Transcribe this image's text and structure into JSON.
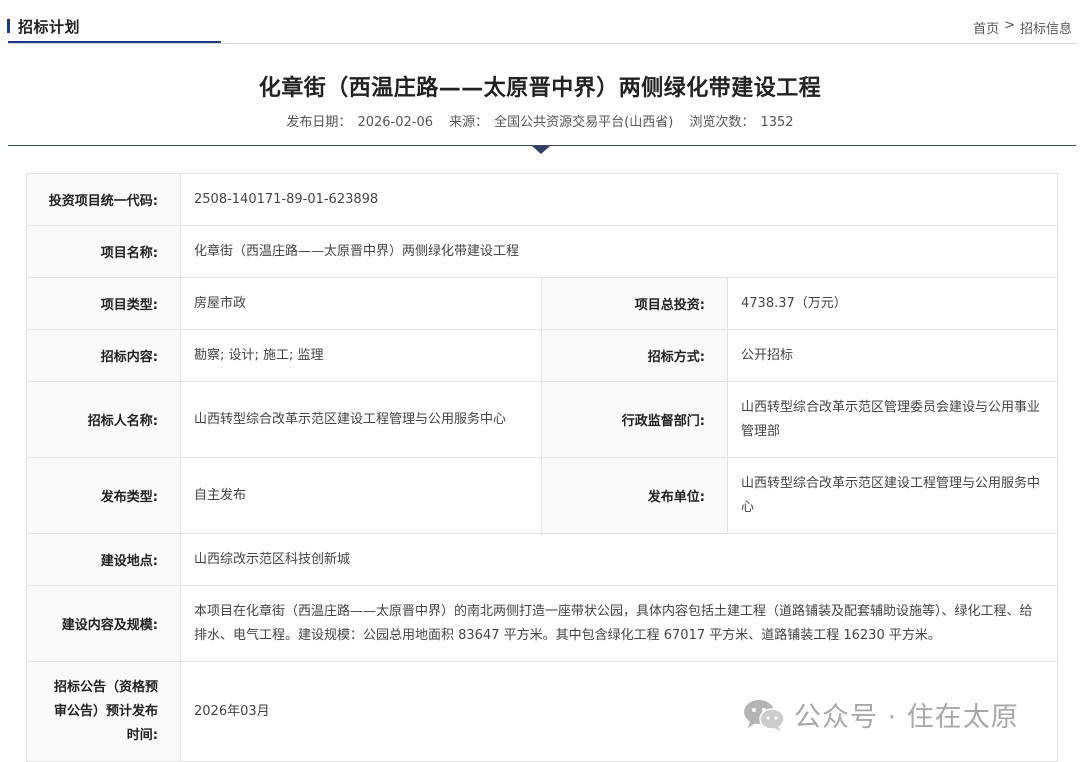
{
  "header": {
    "section_title": "招标计划",
    "breadcrumb": {
      "home": "首页",
      "separator": ">",
      "current": "招标信息"
    }
  },
  "article": {
    "title": "化章街（西温庄路——太原晋中界）两侧绿化带建设工程",
    "meta": {
      "date_label": "发布日期：",
      "date": "2026-02-06",
      "source_label": "来源：",
      "source": "全国公共资源交易平台(山西省)",
      "views_label": "浏览次数：",
      "views": "1352"
    }
  },
  "table": {
    "code_label": "投资项目统一代码:",
    "code_value": "2508-140171-89-01-623898",
    "name_label": "项目名称:",
    "name_value": "化章街（西温庄路——太原晋中界）两侧绿化带建设工程",
    "type_label": "项目类型:",
    "type_value": "房屋市政",
    "invest_label": "项目总投资:",
    "invest_value": "4738.37（万元）",
    "content_label": "招标内容:",
    "content_value": "勘察; 设计; 施工; 监理",
    "method_label": "招标方式:",
    "method_value": "公开招标",
    "tenderer_label": "招标人名称:",
    "tenderer_value": "山西转型综合改革示范区建设工程管理与公用服务中心",
    "supervisor_label": "行政监督部门:",
    "supervisor_value": "山西转型综合改革示范区管理委员会建设与公用事业管理部",
    "pubtype_label": "发布类型:",
    "pubtype_value": "自主发布",
    "pubunit_label": "发布单位:",
    "pubunit_value": "山西转型综合改革示范区建设工程管理与公用服务中心",
    "site_label": "建设地点:",
    "site_value": "山西综改示范区科技创新城",
    "scale_label": "建设内容及规模:",
    "scale_value": "本项目在化章街（西温庄路——太原晋中界）的南北两侧打造一座带状公园，具体内容包括土建工程（道路铺装及配套辅助设施等）、绿化工程、给排水、电气工程。建设规模：公园总用地面积 83647 平方米。其中包含绿化工程 67017 平方米、道路铺装工程 16230 平方米。",
    "notice_label": "招标公告（资格预审公告）预计发布时间:",
    "notice_value": "2026年03月"
  },
  "watermark": {
    "text": "公众号 · 住在太原",
    "icon": "wechat-icon"
  },
  "colors": {
    "accent": "#1f3a8a",
    "divider": "#3b4a6b",
    "border": "#e3e3e3",
    "label_bg": "#fafafa"
  }
}
